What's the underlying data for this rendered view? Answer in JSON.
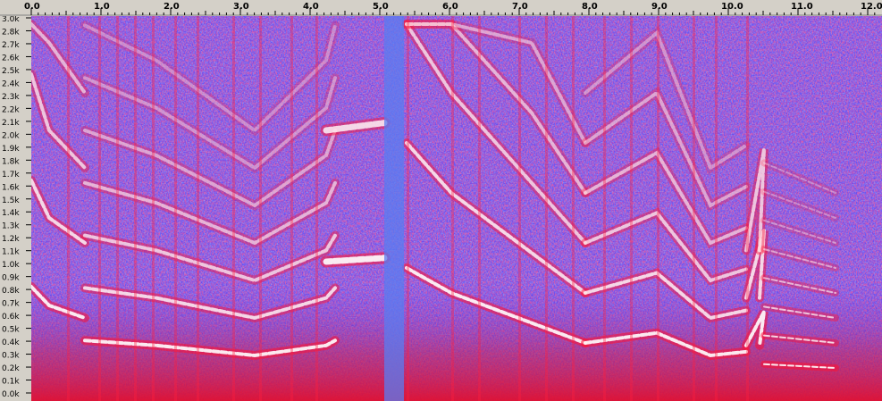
{
  "time_ruler": {
    "labels": [
      "0.0",
      "1.0",
      "2.0",
      "3.0",
      "4.0",
      "5.0",
      "6.0",
      "7.0",
      "8.0",
      "9.0",
      "10.0",
      "11.0",
      "12.0"
    ],
    "start_seconds": 0,
    "end_seconds": 12.4
  },
  "freq_ruler": {
    "labels": [
      "3.0k",
      "2.8k",
      "2.7k",
      "2.6k",
      "2.5k",
      "2.4k",
      "2.3k",
      "2.2k",
      "2.1k",
      "2.0k",
      "1.9k",
      "1.8k",
      "1.7k",
      "1.6k",
      "1.5k",
      "1.4k",
      "1.3k",
      "1.2k",
      "1.1k",
      "1.0k",
      "0.9k",
      "0.8k",
      "0.7k",
      "0.6k",
      "0.5k",
      "0.4k",
      "0.3k",
      "0.2k",
      "0.1k",
      "0.0k"
    ],
    "max_hz": 3000
  },
  "colors": {
    "background": "#6a4cf0",
    "low": "#5a7cf0",
    "mid": "#ff1030",
    "high": "#ffffff"
  }
}
